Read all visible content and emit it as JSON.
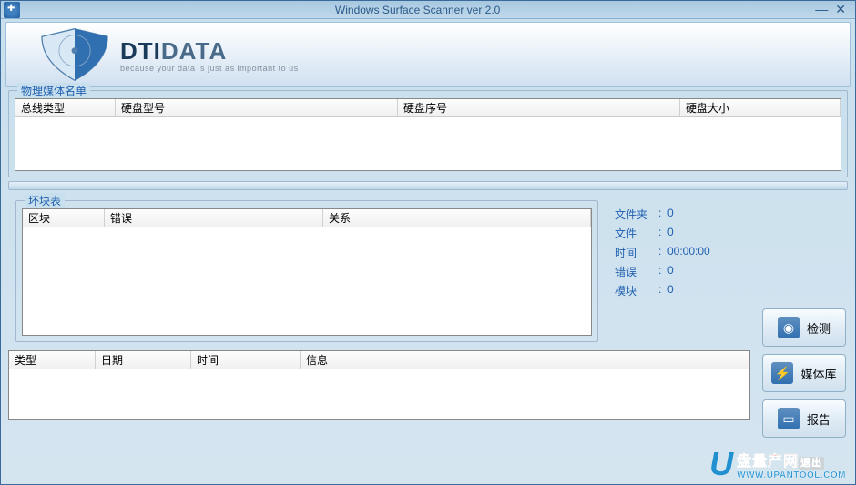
{
  "window": {
    "title": "Windows Surface Scanner ver 2.0"
  },
  "logo": {
    "main_a": "DTI",
    "main_b": "DATA",
    "sub": "because your data is just as important to us"
  },
  "section1": {
    "label": "物理媒体名单",
    "cols": {
      "c1": "总线类型",
      "c2": "硬盘型号",
      "c3": "硬盘序号",
      "c4": "硬盘大小"
    }
  },
  "section2": {
    "label": "坏块表",
    "cols": {
      "c1": "区块",
      "c2": "错误",
      "c3": "关系"
    }
  },
  "stats": {
    "folders_label": "文件夹",
    "folders_value": "0",
    "files_label": "文件",
    "files_value": "0",
    "time_label": "时间",
    "time_value": "00:00:00",
    "errors_label": "错误",
    "errors_value": "0",
    "blocks_label": "模块",
    "blocks_value": "0"
  },
  "buttons": {
    "scan": "检测",
    "media": "媒体库",
    "report": "报告"
  },
  "log": {
    "cols": {
      "c1": "类型",
      "c2": "日期",
      "c3": "时间",
      "c4": "信息"
    }
  },
  "watermark": {
    "u": "U",
    "cn": "盘量产网",
    "exit": "退出",
    "url": "WWW.UPANTOOL.COM"
  }
}
